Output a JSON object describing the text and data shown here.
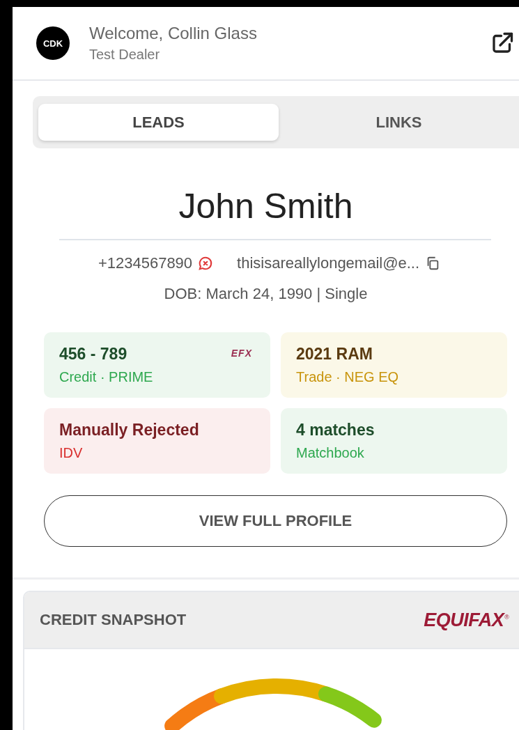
{
  "header": {
    "logo": "CDK",
    "welcome": "Welcome, Collin Glass",
    "dealer": "Test Dealer"
  },
  "tabs": [
    {
      "label": "LEADS",
      "selected": true
    },
    {
      "label": "LINKS",
      "selected": false
    }
  ],
  "lead": {
    "name": "John Smith",
    "phone": "+1234567890",
    "email": "thisisareallylongemail@e...",
    "details": "DOB: March 24, 1990 | Single"
  },
  "cards": [
    {
      "kind": "success",
      "title": "456 - 789",
      "subtitle": "Credit · PRIME",
      "badge": "EFX"
    },
    {
      "kind": "warning",
      "title": "2021 RAM",
      "subtitle": "Trade · NEG EQ"
    },
    {
      "kind": "error",
      "title": "Manually Rejected",
      "subtitle": "IDV"
    },
    {
      "kind": "success",
      "title": "4 matches",
      "subtitle": "Matchbook"
    }
  ],
  "profile_button": "VIEW FULL PROFILE",
  "credit_snapshot": {
    "title": "CREDIT SNAPSHOT",
    "bureau": "EQUIFAX",
    "bureau_mark": "®"
  }
}
